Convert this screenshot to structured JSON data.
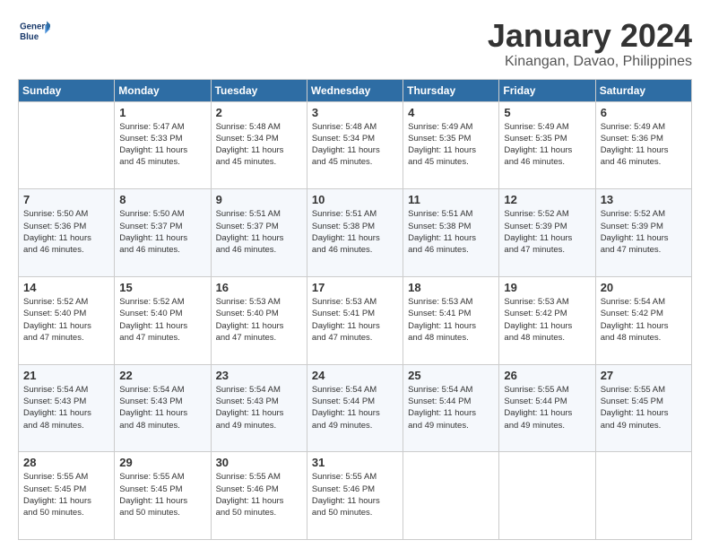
{
  "header": {
    "logo_line1": "General",
    "logo_line2": "Blue",
    "title": "January 2024",
    "subtitle": "Kinangan, Davao, Philippines"
  },
  "columns": [
    "Sunday",
    "Monday",
    "Tuesday",
    "Wednesday",
    "Thursday",
    "Friday",
    "Saturday"
  ],
  "weeks": [
    [
      {
        "day": "",
        "info": ""
      },
      {
        "day": "1",
        "info": "Sunrise: 5:47 AM\nSunset: 5:33 PM\nDaylight: 11 hours\nand 45 minutes."
      },
      {
        "day": "2",
        "info": "Sunrise: 5:48 AM\nSunset: 5:34 PM\nDaylight: 11 hours\nand 45 minutes."
      },
      {
        "day": "3",
        "info": "Sunrise: 5:48 AM\nSunset: 5:34 PM\nDaylight: 11 hours\nand 45 minutes."
      },
      {
        "day": "4",
        "info": "Sunrise: 5:49 AM\nSunset: 5:35 PM\nDaylight: 11 hours\nand 45 minutes."
      },
      {
        "day": "5",
        "info": "Sunrise: 5:49 AM\nSunset: 5:35 PM\nDaylight: 11 hours\nand 46 minutes."
      },
      {
        "day": "6",
        "info": "Sunrise: 5:49 AM\nSunset: 5:36 PM\nDaylight: 11 hours\nand 46 minutes."
      }
    ],
    [
      {
        "day": "7",
        "info": "Sunrise: 5:50 AM\nSunset: 5:36 PM\nDaylight: 11 hours\nand 46 minutes."
      },
      {
        "day": "8",
        "info": "Sunrise: 5:50 AM\nSunset: 5:37 PM\nDaylight: 11 hours\nand 46 minutes."
      },
      {
        "day": "9",
        "info": "Sunrise: 5:51 AM\nSunset: 5:37 PM\nDaylight: 11 hours\nand 46 minutes."
      },
      {
        "day": "10",
        "info": "Sunrise: 5:51 AM\nSunset: 5:38 PM\nDaylight: 11 hours\nand 46 minutes."
      },
      {
        "day": "11",
        "info": "Sunrise: 5:51 AM\nSunset: 5:38 PM\nDaylight: 11 hours\nand 46 minutes."
      },
      {
        "day": "12",
        "info": "Sunrise: 5:52 AM\nSunset: 5:39 PM\nDaylight: 11 hours\nand 47 minutes."
      },
      {
        "day": "13",
        "info": "Sunrise: 5:52 AM\nSunset: 5:39 PM\nDaylight: 11 hours\nand 47 minutes."
      }
    ],
    [
      {
        "day": "14",
        "info": "Sunrise: 5:52 AM\nSunset: 5:40 PM\nDaylight: 11 hours\nand 47 minutes."
      },
      {
        "day": "15",
        "info": "Sunrise: 5:52 AM\nSunset: 5:40 PM\nDaylight: 11 hours\nand 47 minutes."
      },
      {
        "day": "16",
        "info": "Sunrise: 5:53 AM\nSunset: 5:40 PM\nDaylight: 11 hours\nand 47 minutes."
      },
      {
        "day": "17",
        "info": "Sunrise: 5:53 AM\nSunset: 5:41 PM\nDaylight: 11 hours\nand 47 minutes."
      },
      {
        "day": "18",
        "info": "Sunrise: 5:53 AM\nSunset: 5:41 PM\nDaylight: 11 hours\nand 48 minutes."
      },
      {
        "day": "19",
        "info": "Sunrise: 5:53 AM\nSunset: 5:42 PM\nDaylight: 11 hours\nand 48 minutes."
      },
      {
        "day": "20",
        "info": "Sunrise: 5:54 AM\nSunset: 5:42 PM\nDaylight: 11 hours\nand 48 minutes."
      }
    ],
    [
      {
        "day": "21",
        "info": "Sunrise: 5:54 AM\nSunset: 5:43 PM\nDaylight: 11 hours\nand 48 minutes."
      },
      {
        "day": "22",
        "info": "Sunrise: 5:54 AM\nSunset: 5:43 PM\nDaylight: 11 hours\nand 48 minutes."
      },
      {
        "day": "23",
        "info": "Sunrise: 5:54 AM\nSunset: 5:43 PM\nDaylight: 11 hours\nand 49 minutes."
      },
      {
        "day": "24",
        "info": "Sunrise: 5:54 AM\nSunset: 5:44 PM\nDaylight: 11 hours\nand 49 minutes."
      },
      {
        "day": "25",
        "info": "Sunrise: 5:54 AM\nSunset: 5:44 PM\nDaylight: 11 hours\nand 49 minutes."
      },
      {
        "day": "26",
        "info": "Sunrise: 5:55 AM\nSunset: 5:44 PM\nDaylight: 11 hours\nand 49 minutes."
      },
      {
        "day": "27",
        "info": "Sunrise: 5:55 AM\nSunset: 5:45 PM\nDaylight: 11 hours\nand 49 minutes."
      }
    ],
    [
      {
        "day": "28",
        "info": "Sunrise: 5:55 AM\nSunset: 5:45 PM\nDaylight: 11 hours\nand 50 minutes."
      },
      {
        "day": "29",
        "info": "Sunrise: 5:55 AM\nSunset: 5:45 PM\nDaylight: 11 hours\nand 50 minutes."
      },
      {
        "day": "30",
        "info": "Sunrise: 5:55 AM\nSunset: 5:46 PM\nDaylight: 11 hours\nand 50 minutes."
      },
      {
        "day": "31",
        "info": "Sunrise: 5:55 AM\nSunset: 5:46 PM\nDaylight: 11 hours\nand 50 minutes."
      },
      {
        "day": "",
        "info": ""
      },
      {
        "day": "",
        "info": ""
      },
      {
        "day": "",
        "info": ""
      }
    ]
  ]
}
